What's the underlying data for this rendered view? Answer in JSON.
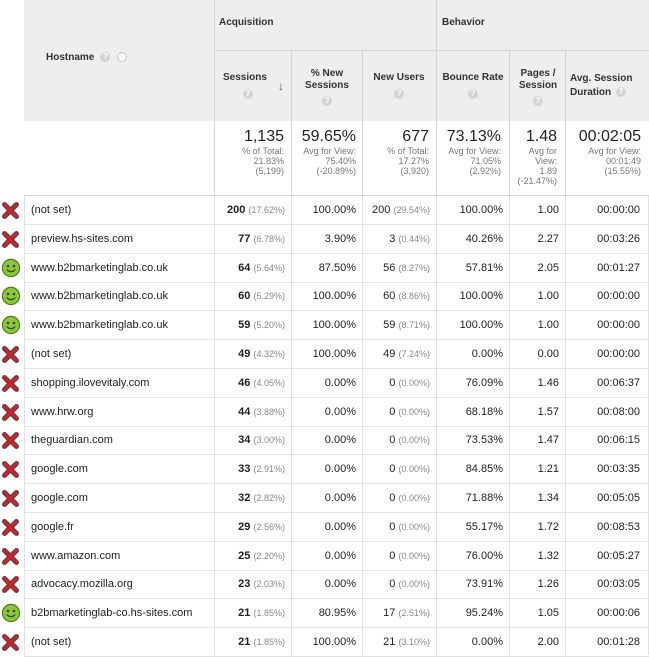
{
  "headers": {
    "hostname": "Hostname",
    "acquisition": "Acquisition",
    "behavior": "Behavior",
    "sessions": "Sessions",
    "new_sessions": "% New Sessions",
    "new_users": "New Users",
    "bounce_rate": "Bounce Rate",
    "pages_session": "Pages / Session",
    "avg_session_duration": "Avg. Session Duration",
    "help_icon": "?",
    "sort_arrow": "↓"
  },
  "totals": {
    "sessions": {
      "value": "1,135",
      "l1": "% of Total:",
      "l2": "21.83%",
      "l3": "(5,199)"
    },
    "new_sessions": {
      "value": "59.65%",
      "l1": "Avg for View:",
      "l2": "75.40%",
      "l3": "(-20.89%)"
    },
    "new_users": {
      "value": "677",
      "l1": "% of Total:",
      "l2": "17.27%",
      "l3": "(3,920)"
    },
    "bounce_rate": {
      "value": "73.13%",
      "l1": "Avg for View:",
      "l2": "71.05%",
      "l3": "(2.92%)"
    },
    "pages_session": {
      "value": "1.48",
      "l1": "Avg for",
      "l2": "View:",
      "l3": "1.89",
      "l4": "(-21.47%)"
    },
    "avg_duration": {
      "value": "00:02:05",
      "l1": "Avg for View:",
      "l2": "00:01:49",
      "l3": "(15.55%)"
    }
  },
  "rows": [
    {
      "status": "x",
      "host": "(not set)",
      "sessions": "200",
      "sessions_pct": "(17.62%)",
      "new_sessions": "100.00%",
      "new_users": "200",
      "new_users_pct": "(29.54%)",
      "bounce": "100.00%",
      "pages": "1.00",
      "duration": "00:00:00"
    },
    {
      "status": "x",
      "host": "preview.hs-sites.com",
      "sessions": "77",
      "sessions_pct": "(6.78%)",
      "new_sessions": "3.90%",
      "new_users": "3",
      "new_users_pct": "(0.44%)",
      "bounce": "40.26%",
      "pages": "2.27",
      "duration": "00:03:26"
    },
    {
      "status": "smile",
      "host": "www.b2bmarketinglab.co.uk",
      "sessions": "64",
      "sessions_pct": "(5.64%)",
      "new_sessions": "87.50%",
      "new_users": "56",
      "new_users_pct": "(8.27%)",
      "bounce": "57.81%",
      "pages": "2.05",
      "duration": "00:01:27"
    },
    {
      "status": "smile",
      "host": "www.b2bmarketinglab.co.uk",
      "sessions": "60",
      "sessions_pct": "(5.29%)",
      "new_sessions": "100.00%",
      "new_users": "60",
      "new_users_pct": "(8.86%)",
      "bounce": "100.00%",
      "pages": "1.00",
      "duration": "00:00:00"
    },
    {
      "status": "smile",
      "host": "www.b2bmarketinglab.co.uk",
      "sessions": "59",
      "sessions_pct": "(5.20%)",
      "new_sessions": "100.00%",
      "new_users": "59",
      "new_users_pct": "(8.71%)",
      "bounce": "100.00%",
      "pages": "1.00",
      "duration": "00:00:00"
    },
    {
      "status": "x",
      "host": "(not set)",
      "sessions": "49",
      "sessions_pct": "(4.32%)",
      "new_sessions": "100.00%",
      "new_users": "49",
      "new_users_pct": "(7.24%)",
      "bounce": "0.00%",
      "pages": "0.00",
      "duration": "00:00:00"
    },
    {
      "status": "x",
      "host": "shopping.ilovevitaly.com",
      "sessions": "46",
      "sessions_pct": "(4.05%)",
      "new_sessions": "0.00%",
      "new_users": "0",
      "new_users_pct": "(0.00%)",
      "bounce": "76.09%",
      "pages": "1.46",
      "duration": "00:06:37"
    },
    {
      "status": "x",
      "host": "www.hrw.org",
      "sessions": "44",
      "sessions_pct": "(3.88%)",
      "new_sessions": "0.00%",
      "new_users": "0",
      "new_users_pct": "(0.00%)",
      "bounce": "68.18%",
      "pages": "1.57",
      "duration": "00:08:00"
    },
    {
      "status": "x",
      "host": "theguardian.com",
      "sessions": "34",
      "sessions_pct": "(3.00%)",
      "new_sessions": "0.00%",
      "new_users": "0",
      "new_users_pct": "(0.00%)",
      "bounce": "73.53%",
      "pages": "1.47",
      "duration": "00:06:15"
    },
    {
      "status": "x",
      "host": "google.com",
      "sessions": "33",
      "sessions_pct": "(2.91%)",
      "new_sessions": "0.00%",
      "new_users": "0",
      "new_users_pct": "(0.00%)",
      "bounce": "84.85%",
      "pages": "1.21",
      "duration": "00:03:35"
    },
    {
      "status": "x",
      "host": "google.com",
      "sessions": "32",
      "sessions_pct": "(2.82%)",
      "new_sessions": "0.00%",
      "new_users": "0",
      "new_users_pct": "(0.00%)",
      "bounce": "71.88%",
      "pages": "1.34",
      "duration": "00:05:05"
    },
    {
      "status": "x",
      "host": "google.fr",
      "sessions": "29",
      "sessions_pct": "(2.56%)",
      "new_sessions": "0.00%",
      "new_users": "0",
      "new_users_pct": "(0.00%)",
      "bounce": "55.17%",
      "pages": "1.72",
      "duration": "00:08:53"
    },
    {
      "status": "x",
      "host": "www.amazon.com",
      "sessions": "25",
      "sessions_pct": "(2.20%)",
      "new_sessions": "0.00%",
      "new_users": "0",
      "new_users_pct": "(0.00%)",
      "bounce": "76.00%",
      "pages": "1.32",
      "duration": "00:05:27"
    },
    {
      "status": "x",
      "host": "advocacy.mozilla.org",
      "sessions": "23",
      "sessions_pct": "(2.03%)",
      "new_sessions": "0.00%",
      "new_users": "0",
      "new_users_pct": "(0.00%)",
      "bounce": "73.91%",
      "pages": "1.26",
      "duration": "00:03:05"
    },
    {
      "status": "smile",
      "host": "b2bmarketinglab-co.hs-sites.com",
      "sessions": "21",
      "sessions_pct": "(1.85%)",
      "new_sessions": "80.95%",
      "new_users": "17",
      "new_users_pct": "(2.51%)",
      "bounce": "95.24%",
      "pages": "1.05",
      "duration": "00:00:06"
    },
    {
      "status": "x",
      "host": "(not set)",
      "sessions": "21",
      "sessions_pct": "(1.85%)",
      "new_sessions": "100.00%",
      "new_users": "21",
      "new_users_pct": "(3.10%)",
      "bounce": "0.00%",
      "pages": "2.00",
      "duration": "00:01:28"
    }
  ],
  "colors": {
    "header_bg": "#eeeeee",
    "x_red": "#d0202a",
    "smile_green": "#8cc63f"
  }
}
